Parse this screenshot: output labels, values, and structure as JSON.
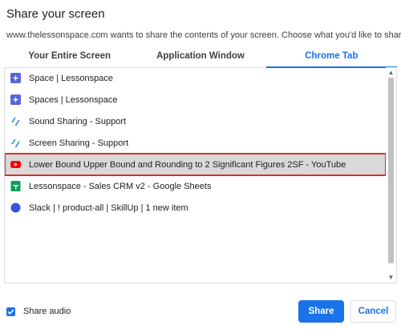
{
  "dialog": {
    "title": "Share your screen",
    "description": "www.thelessonspace.com wants to share the contents of your screen. Choose what you'd like to share."
  },
  "tabs": [
    {
      "label": "Your Entire Screen",
      "active": false
    },
    {
      "label": "Application Window",
      "active": false
    },
    {
      "label": "Chrome Tab",
      "active": true
    }
  ],
  "tab_list": [
    {
      "label": "Space | Lessonspace",
      "icon": "lessonspace-icon",
      "selected": false
    },
    {
      "label": "Spaces | Lessonspace",
      "icon": "lessonspace-icon",
      "selected": false
    },
    {
      "label": "Sound Sharing - Support",
      "icon": "support-slash-icon",
      "selected": false
    },
    {
      "label": "Screen Sharing - Support",
      "icon": "support-slash-icon",
      "selected": false
    },
    {
      "label": "Lower Bound Upper Bound and Rounding to 2 Significant Figures 2SF - YouTube",
      "icon": "youtube-icon",
      "selected": true
    },
    {
      "label": "Lessonspace - Sales CRM v2 - Google Sheets",
      "icon": "google-sheets-icon",
      "selected": false
    },
    {
      "label": "Slack | ! product-all | SkillUp | 1 new item",
      "icon": "slack-dot-icon",
      "selected": false
    }
  ],
  "footer": {
    "share_audio_label": "Share audio",
    "share_audio_checked": true,
    "share_label": "Share",
    "cancel_label": "Cancel"
  },
  "colors": {
    "accent": "#1a73e8",
    "selection_outline": "#d93025",
    "selection_bg": "#d9d9d9"
  }
}
